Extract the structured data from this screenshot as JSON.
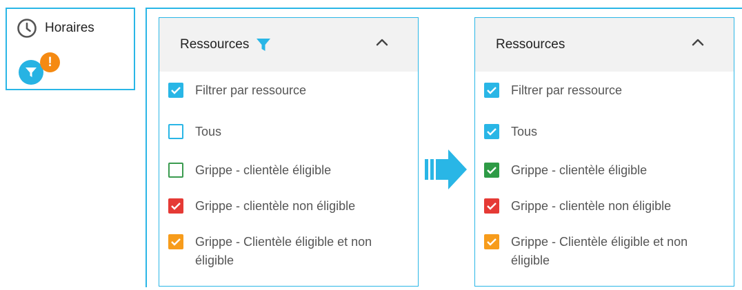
{
  "sidebar": {
    "horaires_label": "Horaires",
    "alert_badge": "!"
  },
  "before_panel": {
    "title": "Ressources",
    "options": [
      {
        "label": "Filtrer par ressource",
        "state": "checked",
        "color": "#29b6e6"
      },
      {
        "label": "Tous",
        "state": "unchecked",
        "color": "#29b6e6"
      },
      {
        "label": "Grippe - clientèle éligible",
        "state": "unchecked",
        "color": "#3a9b4f"
      },
      {
        "label": "Grippe - clientèle non éligible",
        "state": "checked",
        "color": "#e53a35"
      },
      {
        "label": "Grippe - Clientèle éligible et non éligible",
        "state": "checked",
        "color": "#f79c1b"
      }
    ]
  },
  "after_panel": {
    "title": "Ressources",
    "options": [
      {
        "label": "Filtrer par ressource",
        "state": "checked",
        "color": "#29b6e6"
      },
      {
        "label": "Tous",
        "state": "checked",
        "color": "#29b6e6"
      },
      {
        "label": "Grippe - clientèle éligible",
        "state": "checked",
        "color": "#2e9b46"
      },
      {
        "label": "Grippe - clientèle non éligible",
        "state": "checked",
        "color": "#e53a35"
      },
      {
        "label": "Grippe - Clientèle éligible et non éligible",
        "state": "checked",
        "color": "#f79c1b"
      }
    ]
  },
  "icons": {
    "clock": "clock-icon",
    "filter": "filter-icon",
    "alert": "alert-icon",
    "collapse": "chevron-up-icon",
    "transition": "arrow-right-icon"
  },
  "colors": {
    "accent": "#29b6e6",
    "alert": "#f58a12",
    "green": "#2e9b46",
    "red": "#e53a35",
    "orange": "#f79c1b"
  }
}
